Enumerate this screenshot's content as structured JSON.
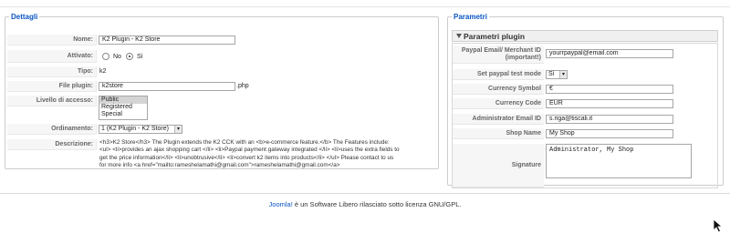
{
  "details": {
    "legend": "Dettagli",
    "fields": {
      "nome": {
        "label": "Nome:",
        "value": "K2 Plugin - K2 Store"
      },
      "attivato": {
        "label": "Attivato:",
        "option_no": "No",
        "option_si": "Sì",
        "selected": "Sì"
      },
      "tipo": {
        "label": "Tipo:",
        "value": "k2"
      },
      "file": {
        "label": "File plugin:",
        "value": "k2store",
        "suffix": ".php"
      },
      "accesso": {
        "label": "Livello di accesso:",
        "options": [
          "Public",
          "Registered",
          "Special"
        ],
        "selected": "Public"
      },
      "ordinamento": {
        "label": "Ordinamento:",
        "value": "1 (K2 Plugin - K2 Store)"
      },
      "descrizione": {
        "label": "Descrizione:",
        "lines": [
          "<h3>K2 Store</h3> The Plugin extends the K2 CCK with an <b>e-commerce feature.</b> The Features include:",
          "<ul> <li>provides an ajax shopping cart </li> <li>Paypal payment gateway integrated </li> <li>uses the extra fields to",
          "get the price information</li> <li>unobtrusive</li> <li>convert k2 items into products</li> </ul> Please contact to us",
          "for more info <a href=\"mailto:rameshelamathi@gmail.com\">rameshelamathi@gmail.com</a>"
        ]
      }
    }
  },
  "params": {
    "legend": "Parametri",
    "panel_title": "Parametri plugin",
    "fields": {
      "paypal_email": {
        "label_line1": "Paypal Email/ Merchant ID",
        "label_line2": "(important!)",
        "value": "yourrpaypal@email.com"
      },
      "test_mode": {
        "label": "Set paypal test mode",
        "value": "Sì"
      },
      "currency_symbol": {
        "label": "Currency Symbol",
        "value": "€"
      },
      "currency_code": {
        "label": "Currency Code",
        "value": "EUR"
      },
      "admin_email": {
        "label": "Administrator Email ID",
        "value": "s.riga@tiscali.it"
      },
      "shop_name": {
        "label": "Shop Name",
        "value": "My Shop"
      },
      "signature": {
        "label": "Signature",
        "value": "Administrator, My Shop"
      }
    }
  },
  "footer": {
    "link": "Joomla!",
    "text": " è un Software Libero rilasciato sotto licenza GNU/GPL."
  }
}
